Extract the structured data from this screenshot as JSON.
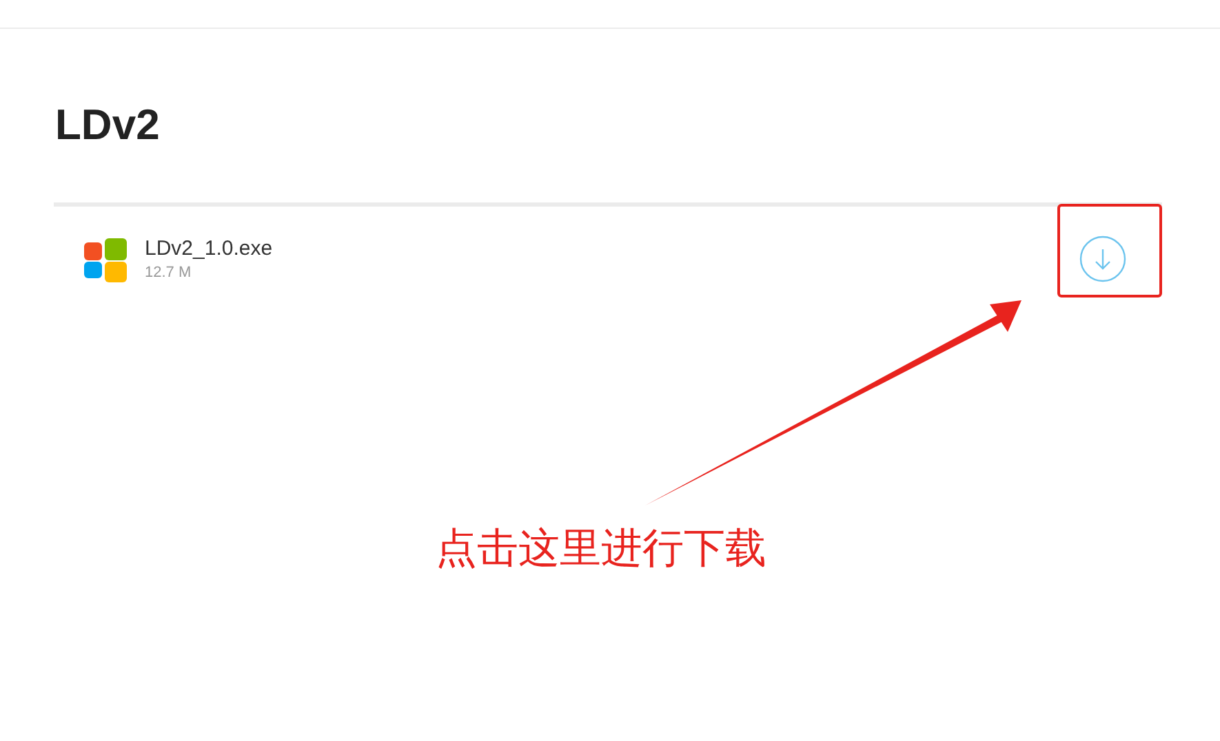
{
  "title": "LDv2",
  "files": [
    {
      "name": "LDv2_1.0.exe",
      "size": "12.7 M"
    }
  ],
  "annotation": {
    "text": "点击这里进行下载"
  }
}
